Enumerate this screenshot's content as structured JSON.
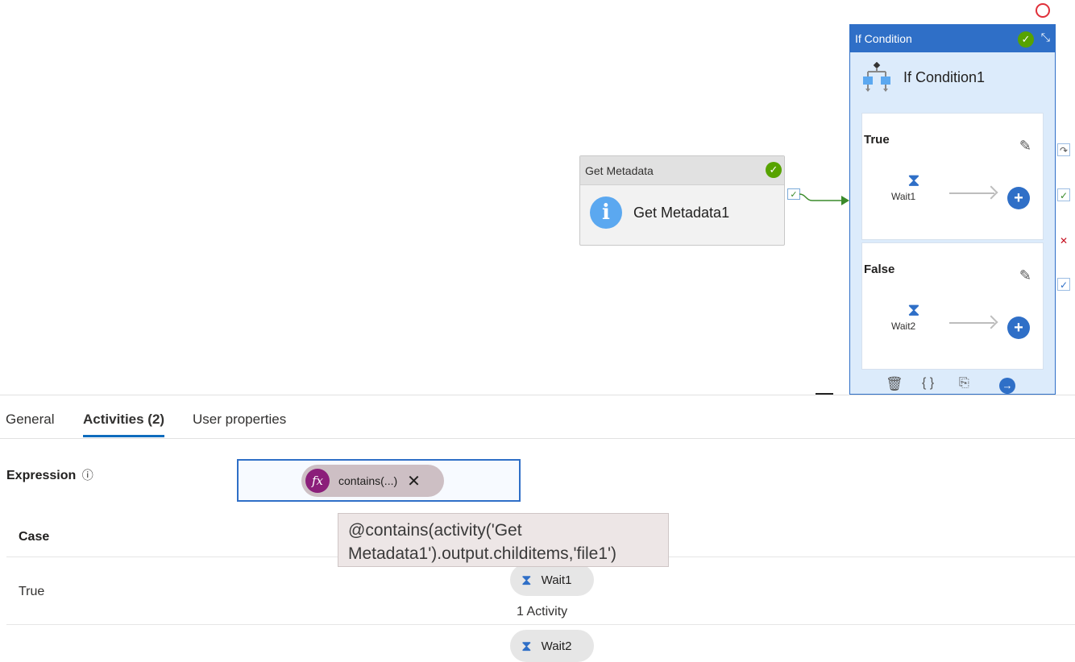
{
  "canvas": {
    "get_metadata": {
      "header": "Get Metadata",
      "name": "Get Metadata1",
      "status_icon": "success-check-icon",
      "icon": "info-icon"
    },
    "if_condition": {
      "header": "If Condition",
      "name": "If Condition1",
      "true_branch": {
        "label": "True",
        "activity": "Wait1"
      },
      "false_branch": {
        "label": "False",
        "activity": "Wait2"
      },
      "toolbar_icons": [
        "delete-icon",
        "code-icon",
        "copy-icon",
        "go-icon"
      ]
    },
    "side_icons": [
      "skip-icon",
      "success-icon",
      "failure-icon",
      "completion-icon"
    ],
    "colors": {
      "accent": "#2f6fc7",
      "success": "#57a300",
      "failure": "#c50f1f"
    }
  },
  "tabs": [
    {
      "label": "General",
      "active": false
    },
    {
      "label": "Activities (2)",
      "active": true
    },
    {
      "label": "User properties",
      "active": false
    }
  ],
  "expression": {
    "label": "Expression",
    "pill_text": "contains(...)",
    "tooltip": "@contains(activity('Get Metadata1').output.childitems,'file1')"
  },
  "cases": {
    "header": "Case",
    "rows": [
      {
        "case": "True",
        "activity": "Wait1",
        "count": "1 Activity"
      },
      {
        "case": "",
        "activity": "Wait2"
      }
    ]
  }
}
